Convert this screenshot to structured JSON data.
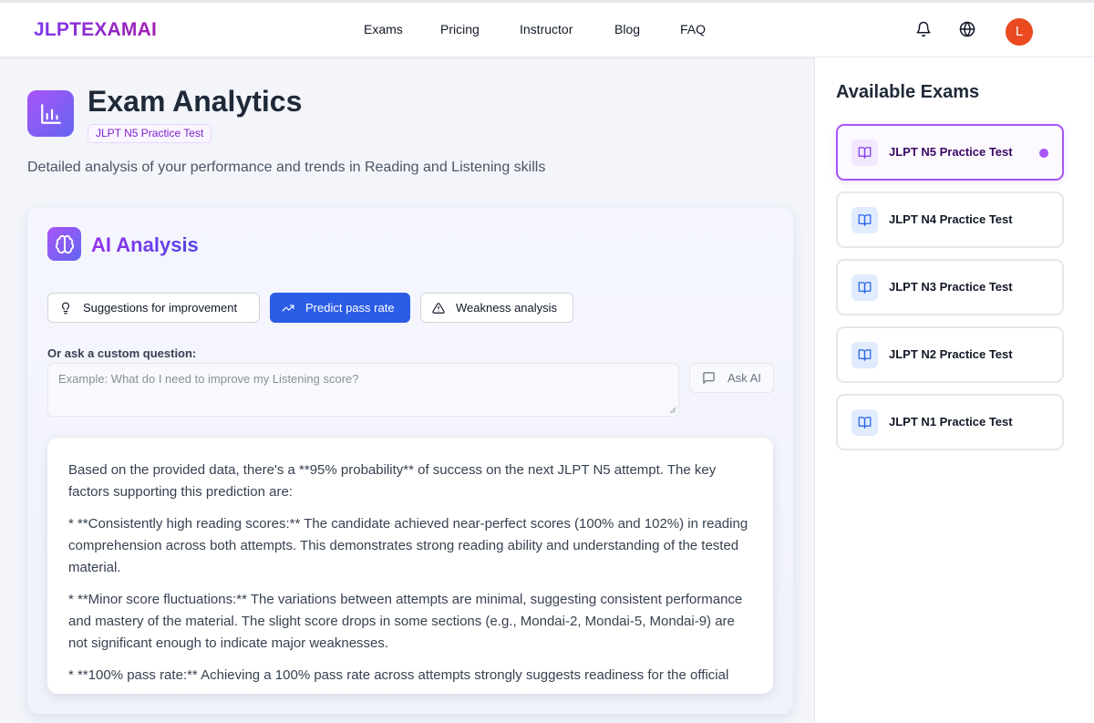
{
  "app": {
    "brand": "JLPTEXAMAI",
    "colors": {
      "brand": "#7c3aed",
      "accent": "#2b5ce6",
      "selected": "#a855f7",
      "avatar": "#ea4a1f"
    }
  },
  "header": {
    "nav": [
      {
        "label": "Exams"
      },
      {
        "label": "Pricing"
      },
      {
        "label": "Instructor"
      },
      {
        "label": "Blog"
      },
      {
        "label": "FAQ"
      }
    ],
    "icons": [
      "bell-icon",
      "globe-icon"
    ],
    "avatar_initial": "L"
  },
  "page": {
    "title": "Exam Analytics",
    "badge": "JLPT N5 Practice Test",
    "subtitle": "Detailed analysis of your performance and trends in Reading and Listening skills"
  },
  "ai": {
    "title": "AI Analysis",
    "actions": [
      {
        "label": "Suggestions for improvement",
        "icon": "lightbulb-icon"
      },
      {
        "label": "Predict pass rate",
        "icon": "trending-up-icon",
        "active": true
      },
      {
        "label": "Weakness analysis",
        "icon": "warning-triangle-icon"
      }
    ],
    "custom_label": "Or ask a custom question:",
    "custom_placeholder": "Example: What do I need to improve my Listening score?",
    "ask_label": "Ask AI",
    "answer": [
      "Based on the provided data, there's a **95% probability** of success on the next JLPT N5 attempt. The key factors supporting this prediction are:",
      "* **Consistently high reading scores:** The candidate achieved near-perfect scores (100% and 102%) in reading comprehension across both attempts. This demonstrates strong reading ability and understanding of the tested material.",
      "* **Minor score fluctuations:** The variations between attempts are minimal, suggesting consistent performance and mastery of the material. The slight score drops in some sections (e.g., Mondai-2, Mondai-5, Mondai-9) are not significant enough to indicate major weaknesses.",
      "* **100% pass rate:** Achieving a 100% pass rate across attempts strongly suggests readiness for the official"
    ]
  },
  "sidebar": {
    "title": "Available Exams",
    "exams": [
      {
        "label": "JLPT N5 Practice Test",
        "selected": true
      },
      {
        "label": "JLPT N4 Practice Test"
      },
      {
        "label": "JLPT N3 Practice Test"
      },
      {
        "label": "JLPT N2 Practice Test"
      },
      {
        "label": "JLPT N1 Practice Test"
      }
    ]
  }
}
